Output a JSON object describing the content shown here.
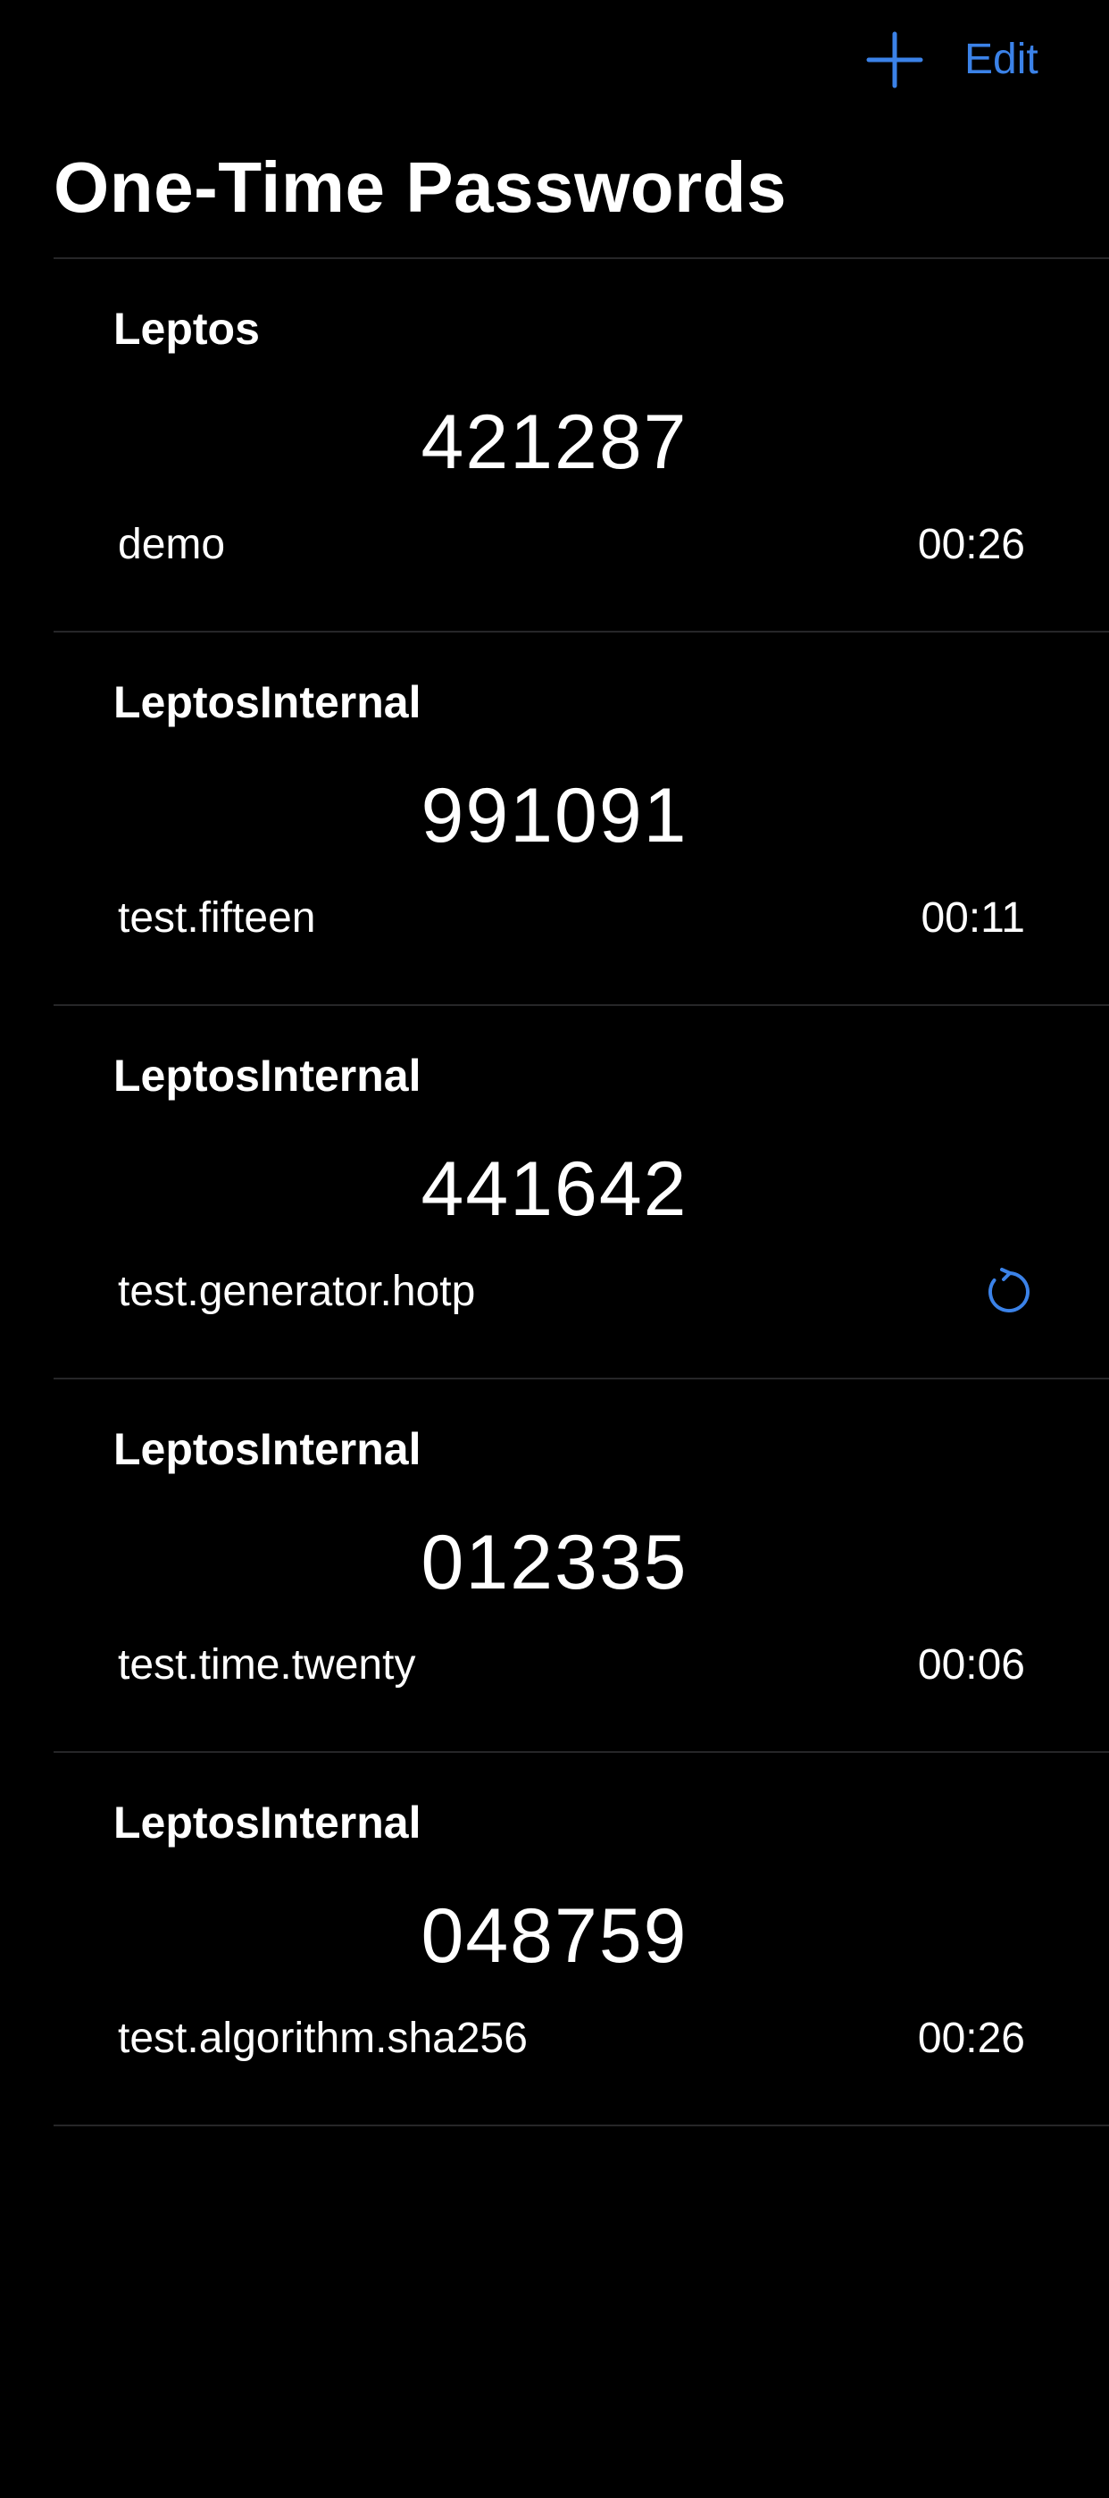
{
  "navbar": {
    "add_icon": "plus-icon",
    "edit_label": "Edit",
    "accent_color": "#3b82e8"
  },
  "page": {
    "title": "One-Time Passwords"
  },
  "tokens": [
    {
      "issuer": "Leptos",
      "code": "421287",
      "account": "demo",
      "timer": "00:26"
    },
    {
      "issuer": "LeptosInternal",
      "code": "991091",
      "account": "test.fifteen",
      "timer": "00:11"
    },
    {
      "issuer": "LeptosInternal",
      "code": "441642",
      "account": "test.generator.hotp",
      "refresh_icon": "refresh-icon"
    },
    {
      "issuer": "LeptosInternal",
      "code": "012335",
      "account": "test.time.twenty",
      "timer": "00:06"
    },
    {
      "issuer": "LeptosInternal",
      "code": "048759",
      "account": "test.algorithm.sha256",
      "timer": "00:26"
    }
  ]
}
